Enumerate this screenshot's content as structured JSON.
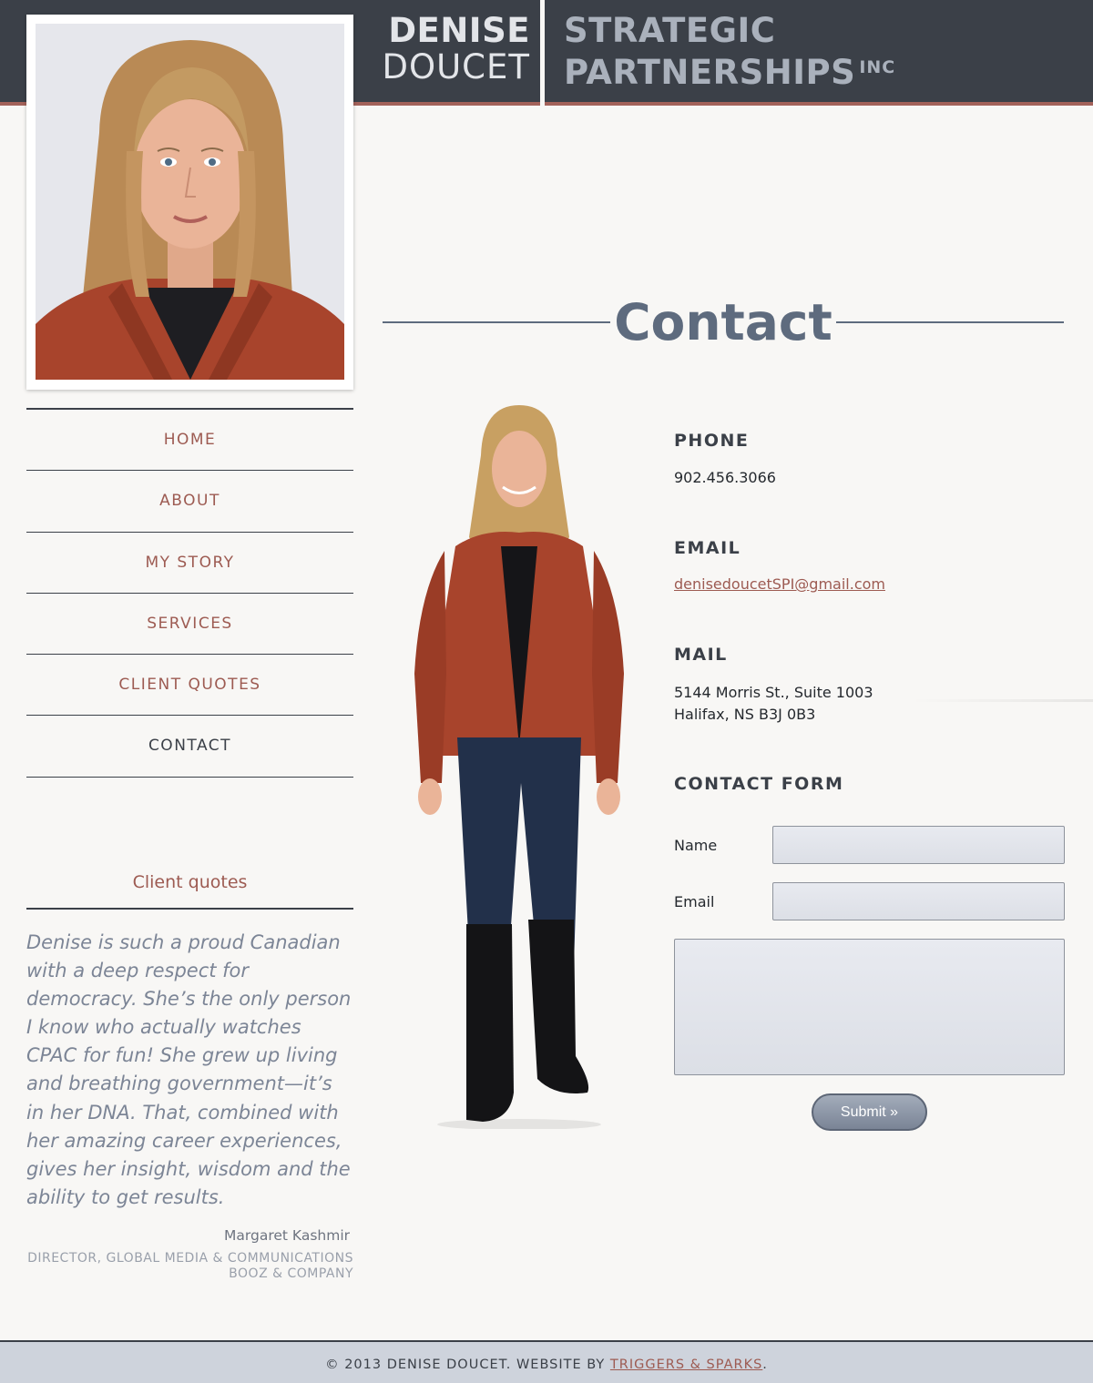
{
  "header": {
    "name_first": "DENISE",
    "name_last": "DOUCET",
    "company_line1": "STRATEGIC",
    "company_line2": "PARTNERSHIPS",
    "company_suffix": "INC"
  },
  "nav": {
    "items": [
      {
        "label": "HOME",
        "active": false
      },
      {
        "label": "ABOUT",
        "active": false
      },
      {
        "label": "MY STORY",
        "active": false
      },
      {
        "label": "SERVICES",
        "active": false
      },
      {
        "label": "CLIENT QUOTES",
        "active": false
      },
      {
        "label": "CONTACT",
        "active": true
      }
    ]
  },
  "client_quotes": {
    "title": "Client quotes",
    "quote": "Denise is such a proud Canadian with a deep respect for democracy. She’s the only person I know who actually watches CPAC for fun! She grew up living and breathing government—it’s in her DNA. That, combined with her amazing career experiences, gives her insight, wisdom and the ability to get results.",
    "author": "Margaret Kashmir",
    "role": "DIRECTOR, GLOBAL MEDIA & COMMUNICATIONS BOOZ & COMPANY"
  },
  "page": {
    "title": "Contact"
  },
  "contact": {
    "phone_heading": "PHONE",
    "phone": "902.456.3066",
    "email_heading": "EMAIL",
    "email": "denisedoucetSPI@gmail.com",
    "mail_heading": "MAIL",
    "mail_line1": "5144 Morris St., Suite 1003",
    "mail_line2": "Halifax, NS B3J 0B3",
    "form_heading": "CONTACT FORM",
    "name_label": "Name",
    "email_label": "Email",
    "name_value": "",
    "email_value": "",
    "message_value": "",
    "submit_label": "Submit »"
  },
  "footer": {
    "text": "© 2013 DENISE DOUCET. WEBSITE BY",
    "link": "TRIGGERS & SPARKS",
    "end": "."
  },
  "colors": {
    "header_bg": "#3b4048",
    "accent": "#9d5b52",
    "footer_bg": "#ced3dc",
    "page_bg": "#f8f7f5"
  }
}
